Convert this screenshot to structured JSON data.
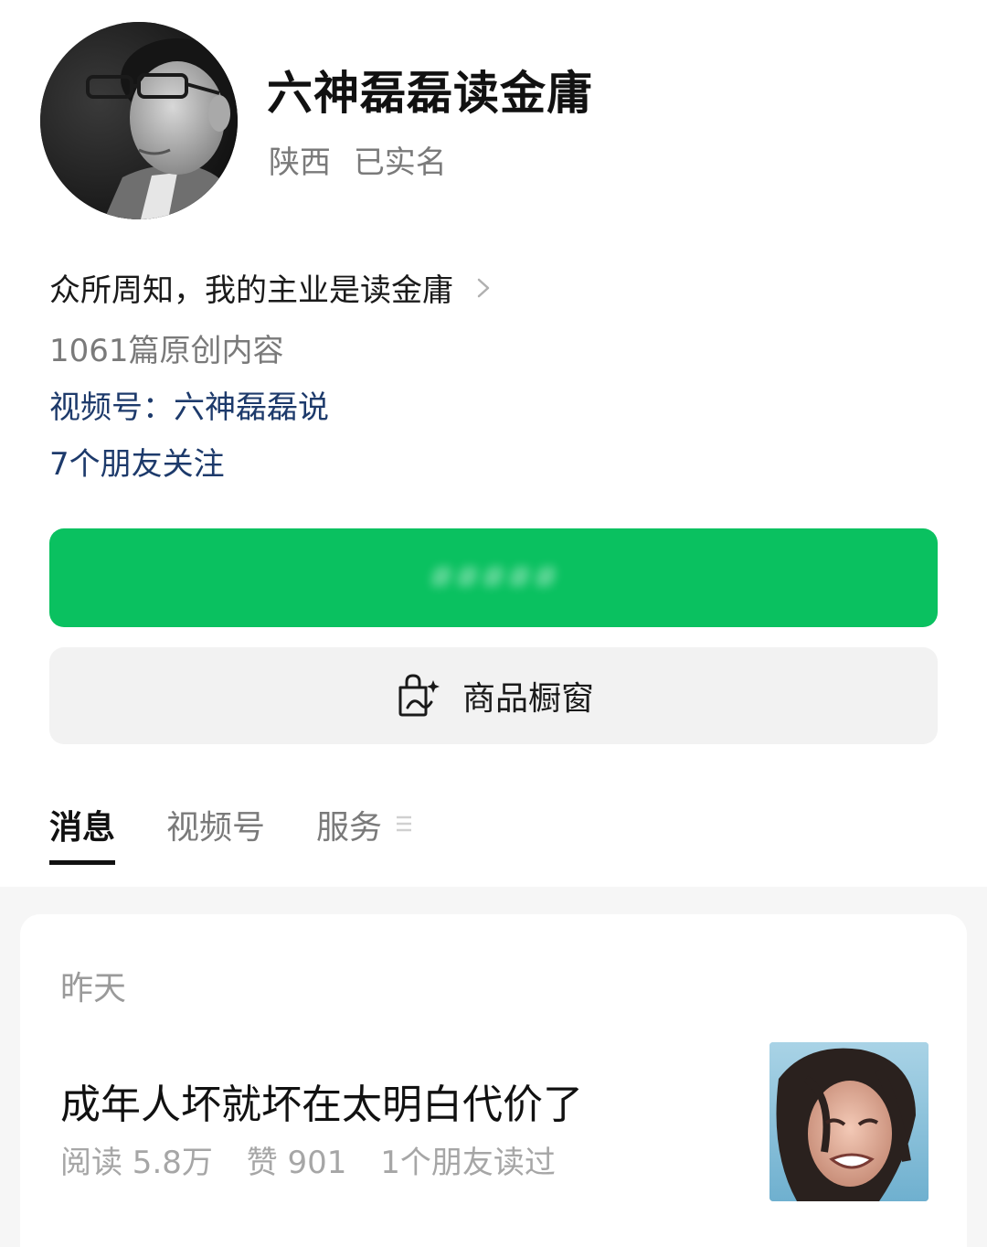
{
  "profile": {
    "name": "六神磊磊读金庸",
    "region": "陕西",
    "verified": "已实名",
    "avatar_icon": "profile-photo"
  },
  "bio": {
    "text": "众所周知，我的主业是读金庸",
    "chevron_icon": "chevron-right-icon"
  },
  "stats": {
    "original_count": "1061篇原创内容"
  },
  "channel": {
    "label": "视频号：六神磊磊说"
  },
  "friends": {
    "label": "7个朋友关注"
  },
  "buttons": {
    "follow_label": "#####",
    "follow_color": "#0ac160",
    "shop_label": "商品橱窗",
    "shop_icon": "shopping-bag-sparkle-icon"
  },
  "tabs": [
    {
      "label": "消息",
      "active": true
    },
    {
      "label": "视频号",
      "active": false
    },
    {
      "label": "服务",
      "active": false
    }
  ],
  "feed": {
    "date": "昨天",
    "article": {
      "title": "成年人坏就坏在太明白代价了",
      "reads": "阅读 5.8万",
      "likes": "赞 901",
      "friends_read": "1个朋友读过",
      "thumbnail_icon": "article-thumbnail"
    }
  }
}
